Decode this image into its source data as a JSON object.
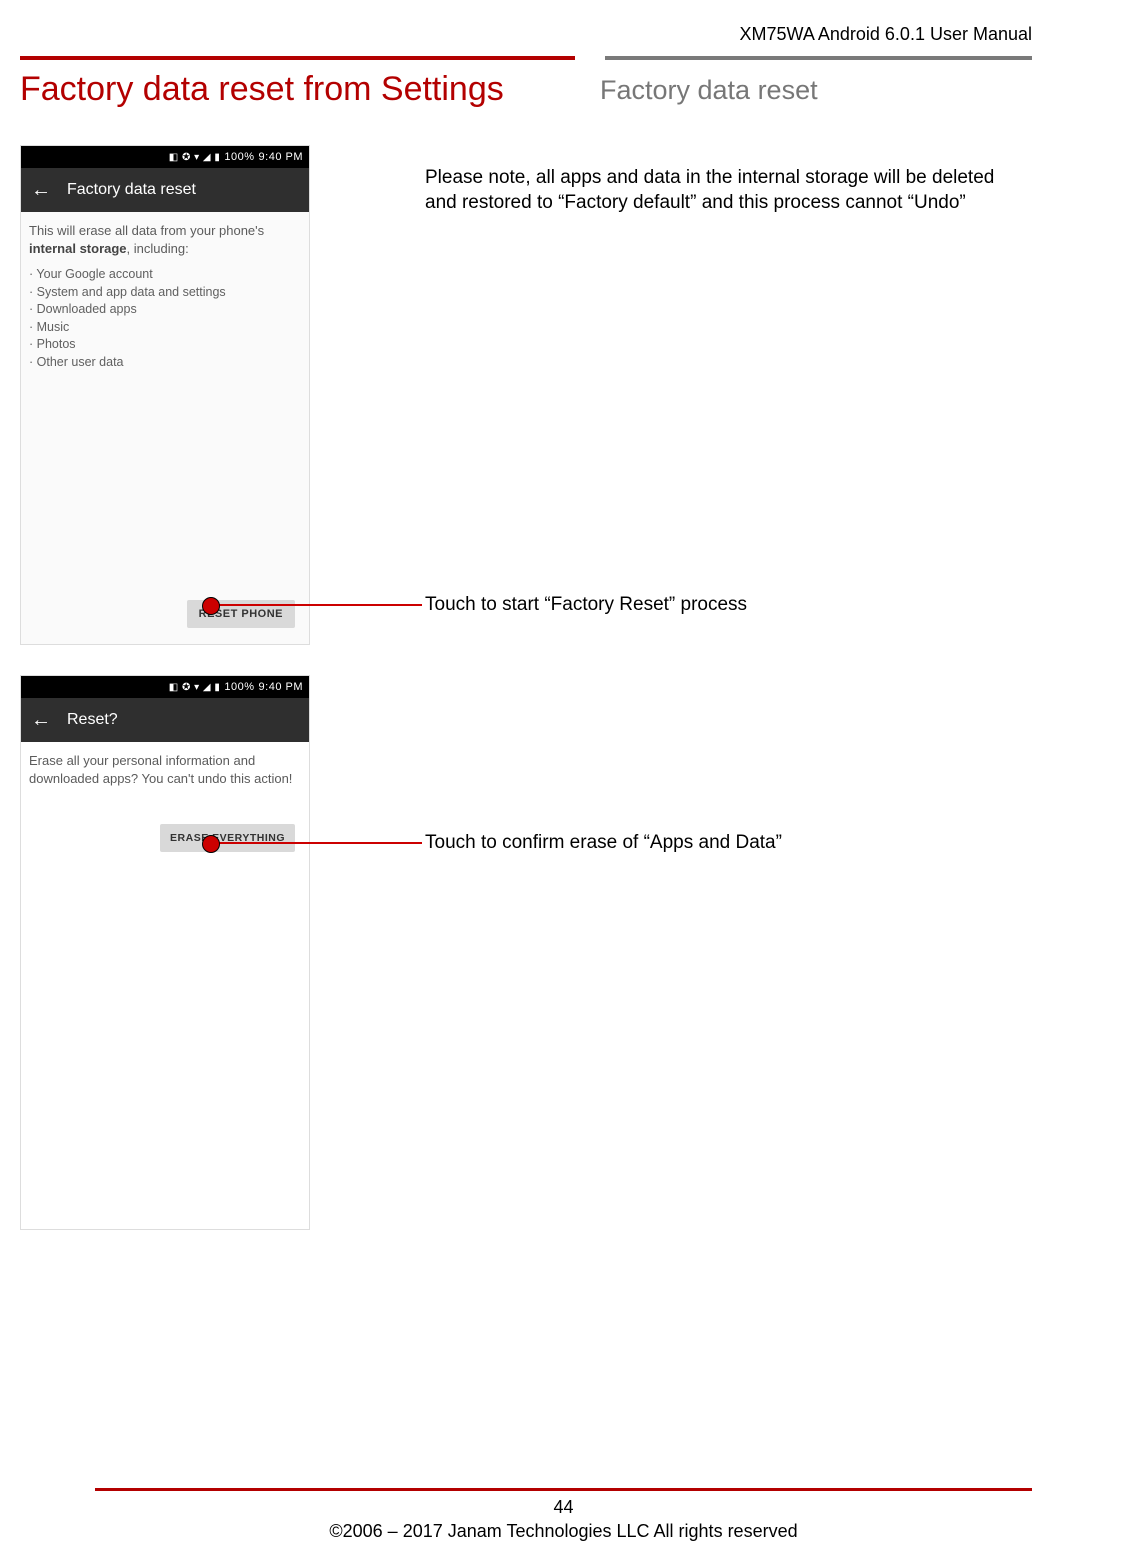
{
  "header": {
    "product": "XM75WA Android 6.0.1 User Manual"
  },
  "titles": {
    "main": "Factory data reset from Settings",
    "side": "Factory data reset"
  },
  "note": "Please note, all apps and data in the internal storage will be deleted and restored to “Factory default” and this process cannot “Undo”",
  "callouts": {
    "reset": "Touch to start “Factory Reset” process",
    "erase": "Touch to confirm erase of “Apps and Data”"
  },
  "status": {
    "battery": "100%",
    "time": "9:40 PM"
  },
  "shot1": {
    "title": "Factory data reset",
    "intro_pre": "This will erase all data from your phone's ",
    "intro_bold": "internal storage",
    "intro_post": ", including:",
    "bullets": [
      "Your Google account",
      "System and app data and settings",
      "Downloaded apps",
      "Music",
      "Photos",
      "Other user data"
    ],
    "button": "RESET PHONE"
  },
  "shot2": {
    "title": "Reset?",
    "body": "Erase all your personal information and downloaded apps? You can't undo this action!",
    "button": "ERASE EVERYTHING"
  },
  "footer": {
    "page": "44",
    "copyright": "©2006 – 2017 Janam Technologies LLC All rights reserved"
  }
}
